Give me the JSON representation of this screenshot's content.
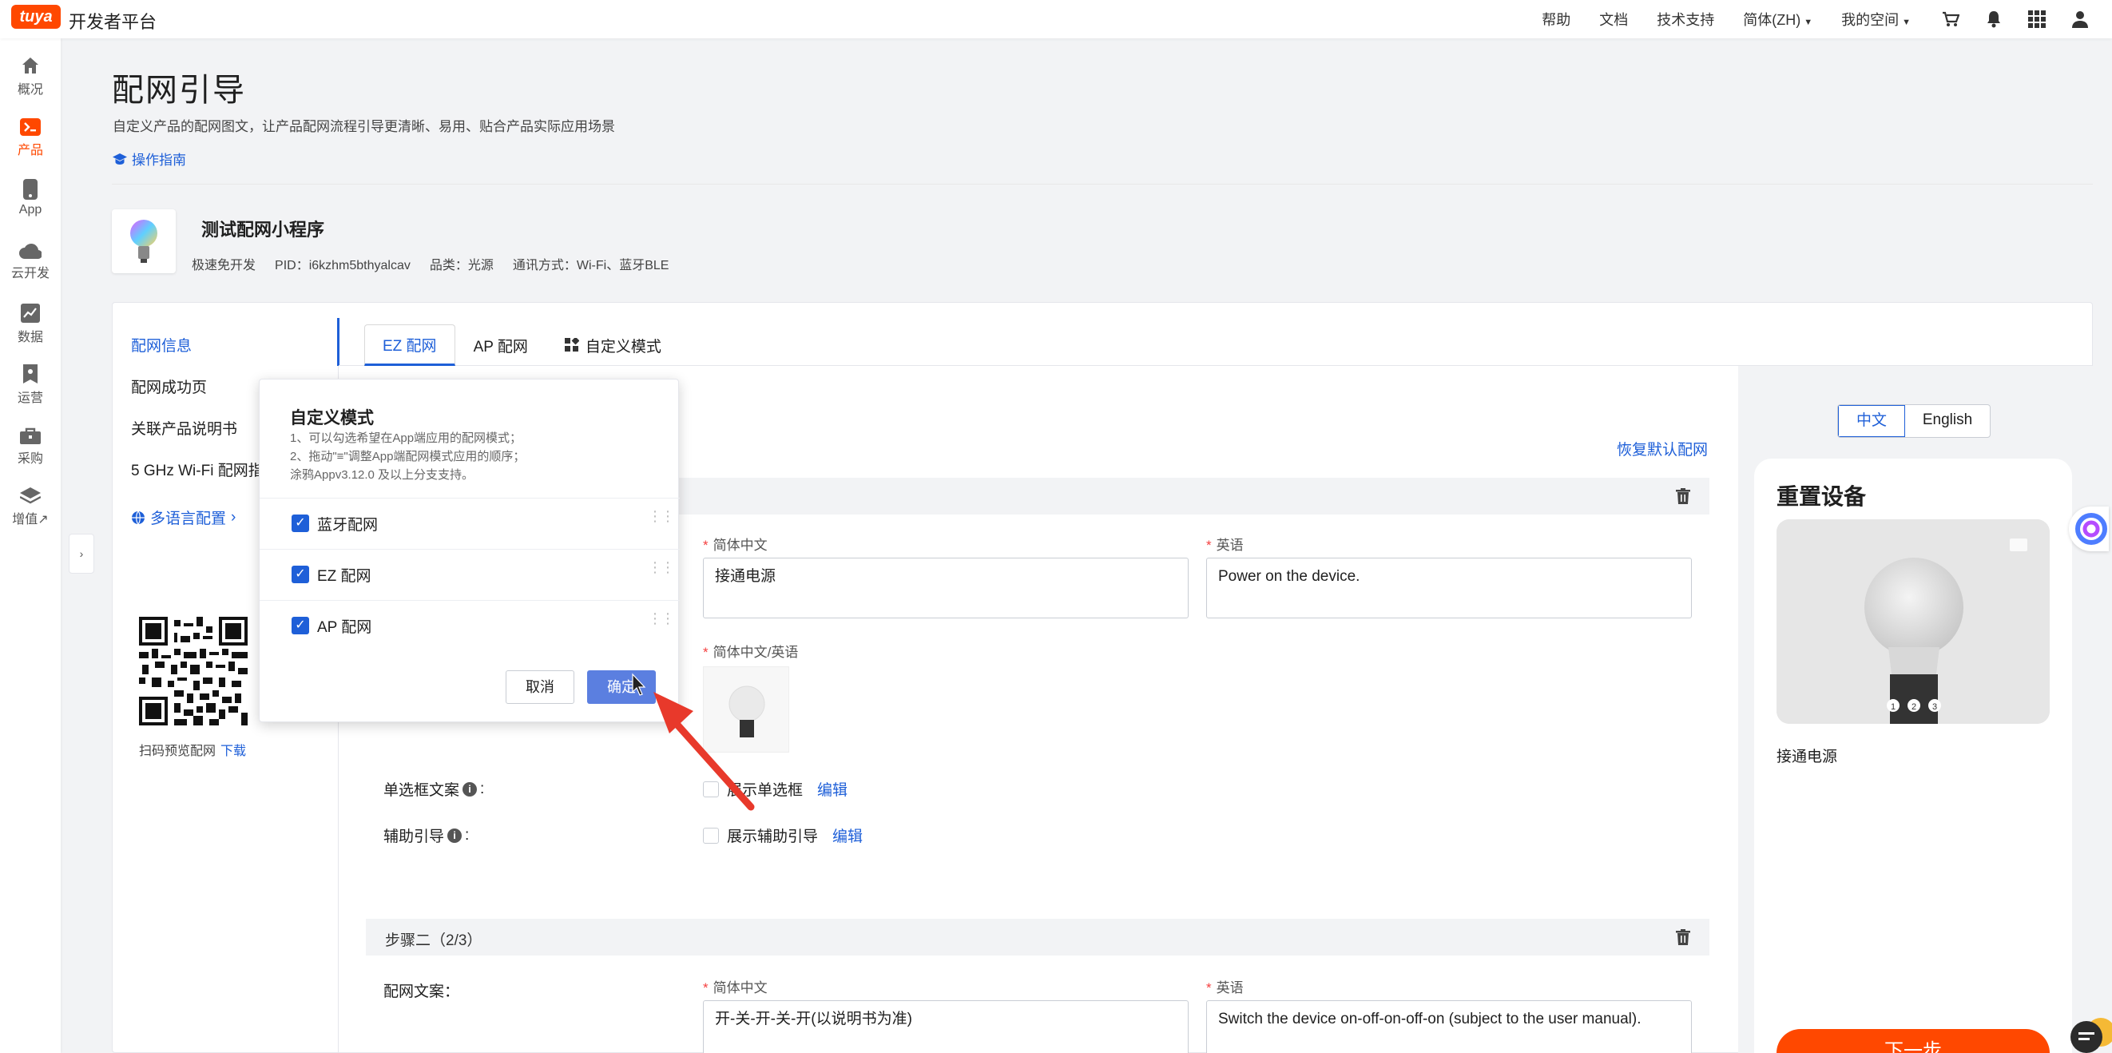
{
  "topbar": {
    "logo_text": "tuya",
    "brand": "开发者平台",
    "links": [
      "帮助",
      "文档",
      "技术支持"
    ],
    "language": "简体(ZH)",
    "space": "我的空间"
  },
  "rail": {
    "items": [
      {
        "label": "概况",
        "icon": "home-icon"
      },
      {
        "label": "产品",
        "icon": "product-icon",
        "active": true
      },
      {
        "label": "App",
        "icon": "phone-icon"
      },
      {
        "label": "云开发",
        "icon": "cloud-icon"
      },
      {
        "label": "数据",
        "icon": "chart-icon"
      },
      {
        "label": "运营",
        "icon": "operation-icon"
      },
      {
        "label": "采购",
        "icon": "purchase-icon"
      },
      {
        "label": "增值↗",
        "icon": "value-added-icon"
      }
    ],
    "collapse": "›"
  },
  "header": {
    "title": "配网引导",
    "description": "自定义产品的配网图文，让产品配网流程引导更清晰、易用、贴合产品实际应用场景",
    "guide_link": "操作指南"
  },
  "product": {
    "name": "测试配网小程序",
    "meta": [
      "极速免开发",
      "PID：i6kzhm5bthyalcav",
      "品类：光源",
      "通讯方式：Wi-Fi、蓝牙BLE"
    ]
  },
  "side_menu": {
    "items": [
      "配网信息",
      "配网成功页",
      "关联产品说明书",
      "5 GHz Wi-Fi 配网指"
    ],
    "lang_config": "多语言配置",
    "qr_caption": "扫码预览配网",
    "qr_download": "下载"
  },
  "tabs": [
    "EZ 配网",
    "AP 配网",
    "自定义模式"
  ],
  "restore_default": "恢复默认配网",
  "step1": {
    "zh_label": "简体中文",
    "en_label": "英语",
    "zh_value": "接通电源",
    "en_value": "Power on the device.",
    "image_label": "简体中文/英语",
    "radio_label": "单选框文案",
    "radio_checkbox": "展示单选框",
    "helper_label": "辅助引导",
    "helper_checkbox": "展示辅助引导",
    "edit": "编辑"
  },
  "step2": {
    "title": "步骤二（2/3）",
    "row_label": "配网文案：",
    "zh_label": "简体中文",
    "en_label": "英语",
    "zh_value": "开-关-开-关-开(以说明书为准)",
    "en_value": "Switch the device on-off-on-off-on (subject to the user manual)."
  },
  "preview": {
    "lang_zh": "中文",
    "lang_en": "English",
    "title": "重置设备",
    "caption": "接通电源",
    "next_button": "下一步",
    "steps": [
      "1",
      "2",
      "3"
    ]
  },
  "popover": {
    "title": "自定义模式",
    "desc1": "1、可以勾选希望在App端应用的配网模式；",
    "desc2": "2、拖动\"≡\"调整App端配网模式应用的顺序；",
    "desc3": "涂鸦Appv3.12.0 及以上分支支持。",
    "options": [
      "蓝牙配网",
      "EZ 配网",
      "AP 配网"
    ],
    "cancel": "取消",
    "confirm": "确定"
  },
  "colors": {
    "brand": "#ff4800",
    "link": "#1e5fd8",
    "annotation_arrow": "#e8392b"
  }
}
